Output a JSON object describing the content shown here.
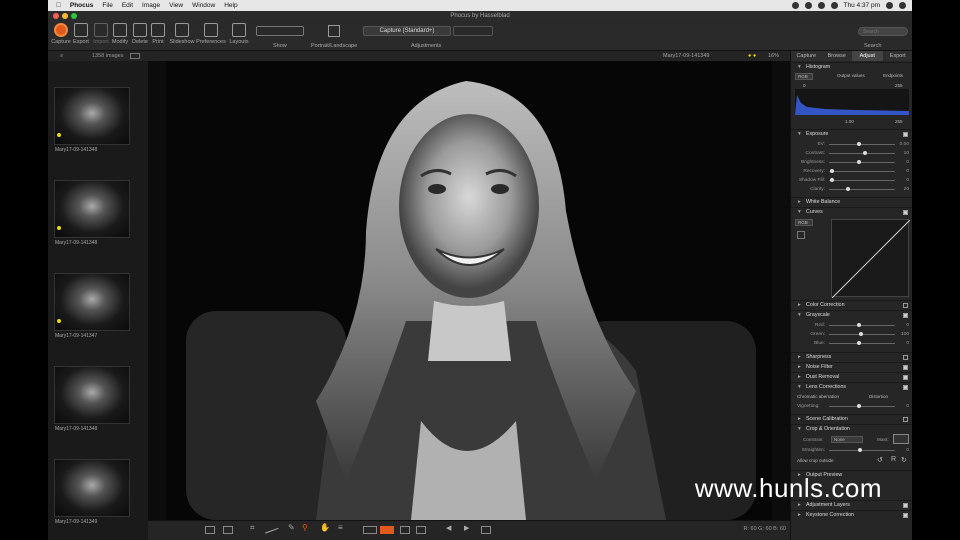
{
  "menubar": {
    "app": "Phocus",
    "items": [
      "File",
      "Edit",
      "Image",
      "View",
      "Window",
      "Help"
    ],
    "clock": "Thu 4:37 pm"
  },
  "window": {
    "title": "Phocus by Hasselblad"
  },
  "toolbar": {
    "buttons": [
      "Capture",
      "Export",
      "Import",
      "Modify",
      "Delete",
      "Print",
      "Slideshow",
      "Preferences",
      "Layouts"
    ],
    "show_label": "Show",
    "portrait_label": "Portrait/Landscape",
    "adjustments_select": "Capture (Standard+)",
    "adjustments_label": "Adjustments",
    "search_placeholder": "Search",
    "search_label": "Search"
  },
  "browser": {
    "count": "1358 images",
    "thumbs": [
      {
        "name": "Mary17-09-141348"
      },
      {
        "name": "Mary17-09-141348"
      },
      {
        "name": "Mary17-09-141347"
      },
      {
        "name": "Mary17-09-141348"
      },
      {
        "name": "Mary17-09-141349"
      }
    ]
  },
  "viewer": {
    "filename": "Mary17-09-141349",
    "zoom": "16%",
    "readout": "R: 60  G: 60  B: 60"
  },
  "panel": {
    "tabs": [
      "Capture",
      "Browse",
      "Adjust",
      "Export"
    ],
    "active_tab": "Adjust",
    "histogram": {
      "title": "Histogram",
      "channel": "RGB",
      "output_values": "Output values",
      "endpoints": "Endpoints",
      "left": "0",
      "right": "255",
      "gamma": "1.00",
      "bottom_right": "255"
    },
    "exposure": {
      "title": "Exposure",
      "rows": [
        {
          "label": "EV:",
          "value": "0,00",
          "pos": 0.45
        },
        {
          "label": "Contrast:",
          "value": "10",
          "pos": 0.55
        },
        {
          "label": "Brightness:",
          "value": "0",
          "pos": 0.45
        },
        {
          "label": "Recovery:",
          "value": "0",
          "pos": 0.02
        },
        {
          "label": "Shadow Fill:",
          "value": "0",
          "pos": 0.02
        },
        {
          "label": "Clarity:",
          "value": "20",
          "pos": 0.28
        }
      ]
    },
    "white_balance": "White Balance",
    "curves": {
      "title": "Curves",
      "channel": "RGB"
    },
    "color_correction": "Color Correction",
    "grayscale": {
      "title": "Grayscale",
      "rows": [
        {
          "label": "Red:",
          "value": "0",
          "pos": 0.45
        },
        {
          "label": "Green:",
          "value": "100",
          "pos": 0.48
        },
        {
          "label": "Blue:",
          "value": "0",
          "pos": 0.45
        }
      ]
    },
    "sharpness": "Sharpness",
    "noise_filter": "Noise Filter",
    "dust_removal": "Dust Removal",
    "lens_corrections": {
      "title": "Lens Corrections",
      "chromatic": "Chromatic aberration",
      "distortion": "Distortion",
      "vignetting": "Vignetting:",
      "vignetting_value": "0",
      "pos": 0.45
    },
    "scene_calibration": "Scene Calibration",
    "crop": {
      "title": "Crop & Orientation",
      "constrain": "Constrain:",
      "constrain_value": "None",
      "mask": "Mask:",
      "straighten": "Straighten:",
      "straighten_value": "0",
      "allow": "Allow crop outside"
    },
    "output_preview": "Output Preview",
    "adjustment_layers": "Adjustment Layers",
    "keystone": "Keystone Correction"
  },
  "watermark": "www.hunls.com"
}
